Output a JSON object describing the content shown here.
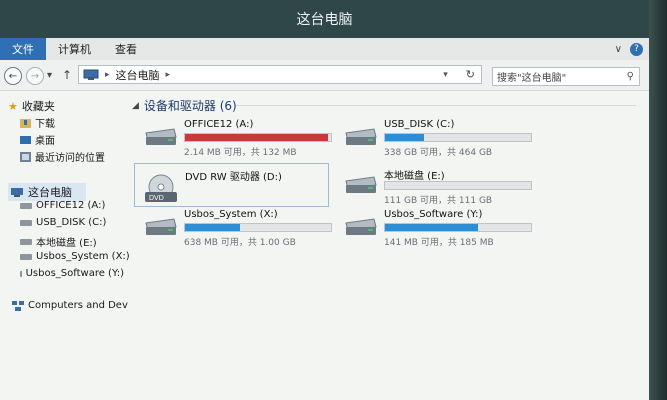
{
  "window": {
    "title": "这台电脑"
  },
  "menu": {
    "file": "文件",
    "computer": "计算机",
    "view": "查看"
  },
  "nav": {
    "back_icon": "arrow-left-icon",
    "forward_icon": "arrow-right-icon",
    "up_icon": "arrow-up-icon",
    "address_path": "这台电脑",
    "refresh_icon": "refresh-icon",
    "search_placeholder": "搜索\"这台电脑\""
  },
  "sidebar": {
    "favorites": "收藏夹",
    "favorites_items": [
      "下载",
      "桌面",
      "最近访问的位置"
    ],
    "this_pc": "这台电脑",
    "pc_items": [
      "OFFICE12 (A:)",
      "USB_DISK (C:)",
      "本地磁盘 (E:)",
      "Usbos_System (X:)",
      "Usbos_Software (Y:)"
    ],
    "network": "Computers and Dev"
  },
  "group": {
    "title": "设备和驱动器 (6)"
  },
  "drives": [
    {
      "name": "OFFICE12 (A:)",
      "space": "2.14 MB 可用，共 132 MB",
      "used_fraction": 0.98,
      "bar_color": "#c8393b"
    },
    {
      "name": "USB_DISK (C:)",
      "space": "338 GB 可用，共 464 GB",
      "used_fraction": 0.27,
      "bar_color": "#2b8ed6"
    },
    {
      "name": "DVD RW 驱动器 (D:)",
      "space": "",
      "used_fraction": null,
      "bar_color": ""
    },
    {
      "name": "本地磁盘 (E:)",
      "space": "111 GB 可用，共 111 GB",
      "used_fraction": 0.0,
      "bar_color": "#2b8ed6"
    },
    {
      "name": "Usbos_System (X:)",
      "space": "638 MB 可用，共 1.00 GB",
      "used_fraction": 0.38,
      "bar_color": "#2b8ed6"
    },
    {
      "name": "Usbos_Software (Y:)",
      "space": "141 MB 可用，共 185 MB",
      "used_fraction": 0.64,
      "bar_color": "#2b8ed6"
    }
  ]
}
